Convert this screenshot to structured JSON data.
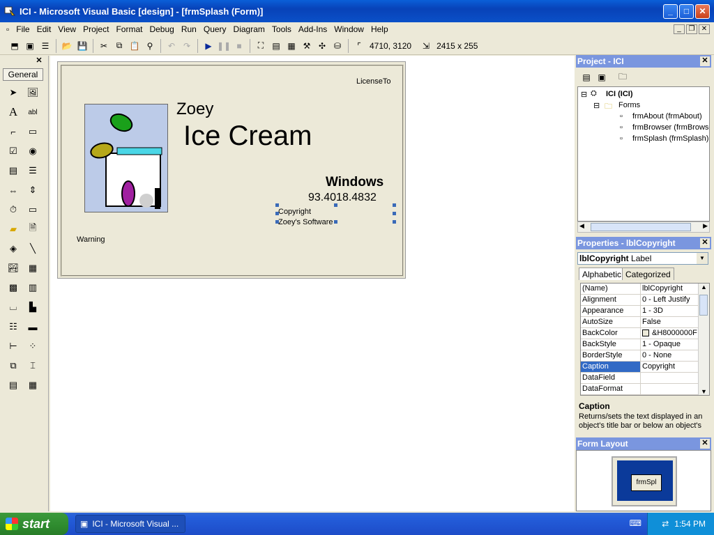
{
  "window": {
    "title": "ICI - Microsoft Visual Basic [design] - [frmSplash (Form)]",
    "controls": {
      "minimize": "_",
      "maximize": "□",
      "close": "✕"
    }
  },
  "menu": [
    "File",
    "Edit",
    "View",
    "Project",
    "Format",
    "Debug",
    "Run",
    "Query",
    "Diagram",
    "Tools",
    "Add-Ins",
    "Window",
    "Help"
  ],
  "toolbar": {
    "position": "4710, 3120",
    "size": "2415 x 255"
  },
  "toolbox": {
    "tab_label": "General",
    "close": "✕"
  },
  "form": {
    "license": "LicenseTo",
    "company_top": "Zoey",
    "product": "Ice Cream",
    "platform": "Windows",
    "version": "93.4018.4832",
    "copyright": "Copyright",
    "company": "Zoey's Software",
    "warning": "Warning"
  },
  "project_panel": {
    "title": "Project - ICI",
    "close": "✕",
    "tree": {
      "root": "ICI (ICI)",
      "forms_folder": "Forms",
      "items": [
        "frmAbout (frmAbout)",
        "frmBrowser (frmBrowse",
        "frmSplash (frmSplash)"
      ]
    }
  },
  "properties_panel": {
    "title": "Properties - lblCopyright",
    "close": "✕",
    "object_name": "lblCopyright",
    "object_type": "Label",
    "tabs": [
      "Alphabetic",
      "Categorized"
    ],
    "rows": [
      {
        "name": "(Name)",
        "value": "lblCopyright"
      },
      {
        "name": "Alignment",
        "value": "0 - Left Justify"
      },
      {
        "name": "Appearance",
        "value": "1 - 3D"
      },
      {
        "name": "AutoSize",
        "value": "False"
      },
      {
        "name": "BackColor",
        "value": "&H8000000F"
      },
      {
        "name": "BackStyle",
        "value": "1 - Opaque"
      },
      {
        "name": "BorderStyle",
        "value": "0 - None"
      },
      {
        "name": "Caption",
        "value": "Copyright"
      },
      {
        "name": "DataField",
        "value": ""
      },
      {
        "name": "DataFormat",
        "value": ""
      }
    ],
    "selected_row": "Caption",
    "description_title": "Caption",
    "description": "Returns/sets the text displayed in an object's title bar or below an object's"
  },
  "layout_panel": {
    "title": "Form Layout",
    "close": "✕",
    "mini_form": "frmSpl"
  },
  "taskbar": {
    "start": "start",
    "task": "ICI - Microsoft Visual ...",
    "clock": "1:54 PM"
  },
  "colors": {
    "titlebar": "#0842b8",
    "panel_header": "#7a96df",
    "selection": "#316ac5",
    "taskbar": "#245edb",
    "start": "#2e8b2e"
  }
}
